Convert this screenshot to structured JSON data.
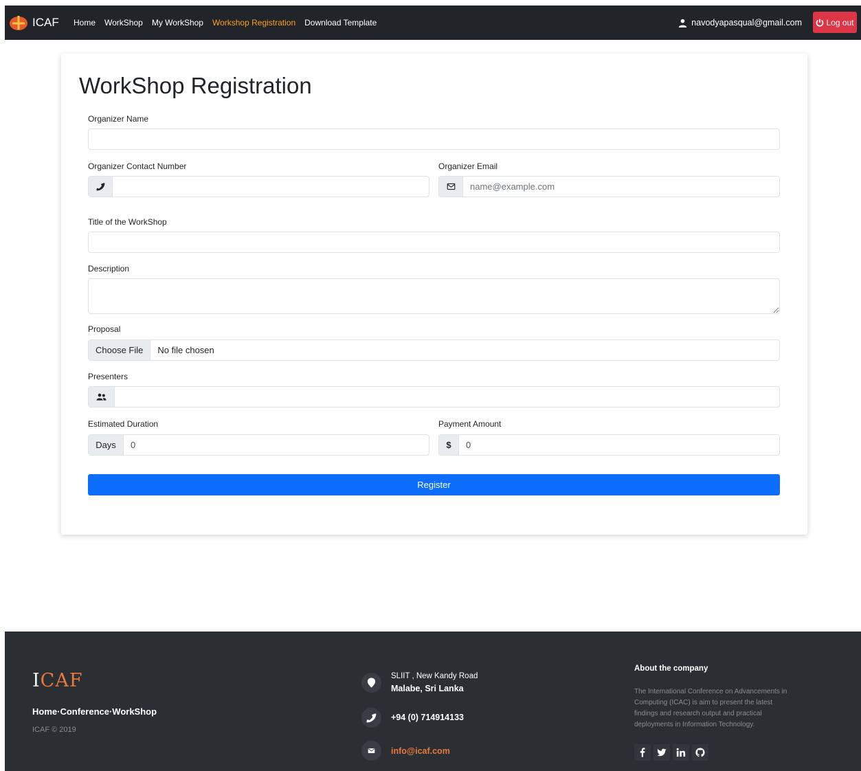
{
  "nav": {
    "brand": "ICAF",
    "links": [
      "Home",
      "WorkShop",
      "My WorkShop",
      "Workshop Registration",
      "Download Template"
    ],
    "user_email": "navodyapasqual@gmail.com",
    "logout_label": "Log out"
  },
  "form": {
    "title": "WorkShop Registration",
    "organizer_name_label": "Organizer Name",
    "contact_label": "Organizer Contact Number",
    "email_label": "Organizer Email",
    "email_placeholder": "name@example.com",
    "workshop_title_label": "Title of the WorkShop",
    "description_label": "Description",
    "proposal_label": "Proposal",
    "file_button": "Choose File",
    "file_status": "No file chosen",
    "presenters_label": "Presenters",
    "duration_label": "Estimated Duration",
    "duration_addon": "Days",
    "duration_value": "0",
    "payment_label": "Payment Amount",
    "payment_addon": "$",
    "payment_value": "0",
    "register_label": "Register"
  },
  "footer": {
    "logo_first": "I",
    "logo_rest": "CAF",
    "links": "Home·Conference·WorkShop",
    "copyright": "ICAF © 2019",
    "address_line1": "SLIIT , New Kandy Road",
    "address_line2": "Malabe, Sri Lanka",
    "phone": "+94 (0) 714914133",
    "email": "info@icaf.com",
    "about_title": "About the company",
    "about_text": "The International Conference on Advancements in Computing (ICAC) is aim to present the latest findings and research output and practical deployments in Information Technology."
  },
  "colors": {
    "navbar": "#212529",
    "active_link": "#ff9f1c",
    "logout": "#dc3545",
    "register": "#0d6efd",
    "footer": "#2b2e33",
    "accent": "#e7793a"
  },
  "icons": [
    "logo-icon",
    "user-icon",
    "power-icon",
    "phone-icon",
    "envelope-icon",
    "users-icon",
    "map-marker-icon",
    "facebook-icon",
    "twitter-icon",
    "linkedin-icon",
    "github-icon"
  ]
}
